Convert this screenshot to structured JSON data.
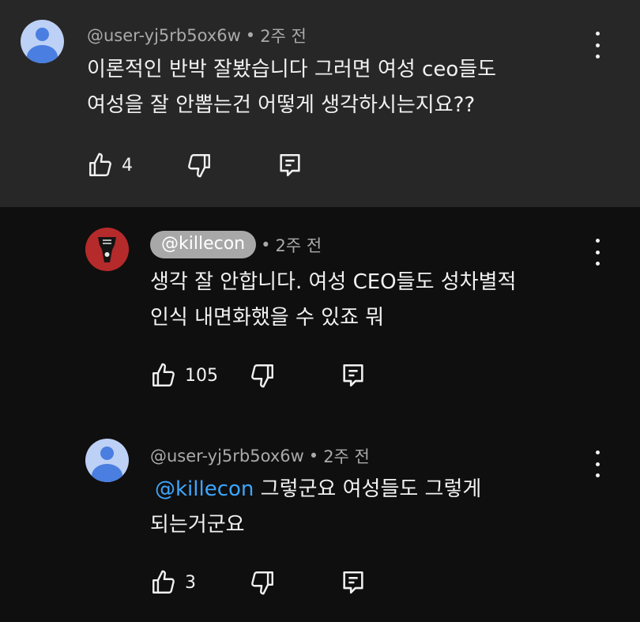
{
  "comments": [
    {
      "author": "@user-yj5rb5ox6w",
      "time": "2주 전",
      "lines": [
        "이론적인 반박 잘봤습니다 그러면 여성 ceo들도",
        "여성을 잘 안뽑는건 어떻게 생각하시는지요??"
      ],
      "likes": "4"
    },
    {
      "author": "@killecon",
      "time": "2주 전",
      "lines": [
        "생각 잘 안합니다. 여성 CEO들도 성차별적",
        "인식 내면화했을 수 있죠 뭐"
      ],
      "likes": "105"
    },
    {
      "author": "@user-yj5rb5ox6w",
      "time": "2주 전",
      "mention": "@killecon",
      "lines": [
        "그렇군요 여성들도 그렇게",
        "되는거군요"
      ],
      "likes": "3"
    }
  ],
  "separator": "•",
  "icons": {
    "like": "thumb-up-icon",
    "dislike": "thumb-down-icon",
    "reply": "reply-icon",
    "menu": "more-vertical-icon",
    "avatar_default": "default-avatar-icon",
    "avatar_channel": "channel-avatar-icon"
  },
  "colors": {
    "background": "#0f0f0f",
    "highlight_background": "#272727",
    "text": "#f1f1f1",
    "meta_text": "#aaaaaa",
    "mention": "#3ea6ff",
    "avatar_default_bg": "#bdd0f5",
    "avatar_default_fg": "#4a7ee0",
    "channel_avatar_bg": "#b52a2a"
  }
}
